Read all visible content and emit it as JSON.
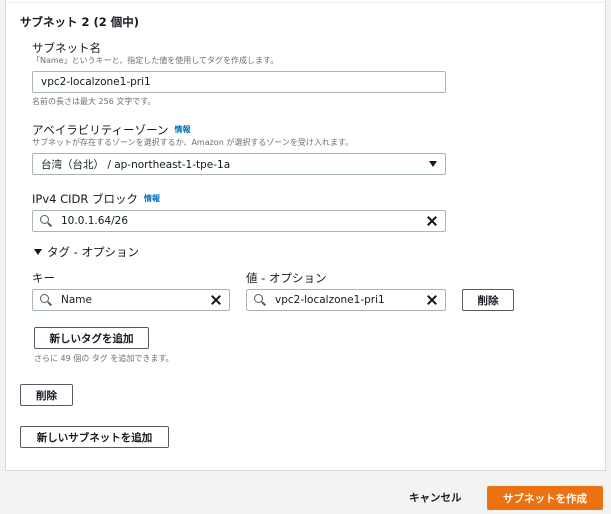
{
  "section": {
    "title": "サブネット 2 (2 個中)"
  },
  "subnet_name": {
    "label": "サブネット名",
    "description": "「Name」というキーと、指定した値を使用してタグを作成します。",
    "value": "vpc2-localzone1-pri1",
    "hint": "名前の長さは最大 256 文字です。"
  },
  "availability_zone": {
    "label": "アベイラビリティーゾーン",
    "info": "情報",
    "description": "サブネットが存在するゾーンを選択するか、Amazon が選択するゾーンを受け入れます。",
    "selected": "台湾（台北） / ap-northeast-1-tpe-1a"
  },
  "cidr": {
    "label": "IPv4 CIDR ブロック",
    "info": "情報",
    "value": "10.0.1.64/26"
  },
  "tags": {
    "toggle_label": "タグ - オプション",
    "key_header": "キー",
    "value_header": "値 - オプション",
    "rows": [
      {
        "key": "Name",
        "value": "vpc2-localzone1-pri1",
        "remove_label": "削除"
      }
    ],
    "add_label": "新しいタグを追加",
    "remaining_hint": "さらに 49 個の タグ を追加できます。"
  },
  "remove_subnet_label": "削除",
  "add_subnet_label": "新しいサブネットを追加",
  "footer": {
    "cancel_label": "キャンセル",
    "create_label": "サブネットを作成"
  },
  "colors": {
    "primary": "#ec7211",
    "link": "#0073bb",
    "border": "#aab7b8"
  },
  "icons": [
    "search-icon",
    "clear-icon",
    "caret-down-icon"
  ]
}
